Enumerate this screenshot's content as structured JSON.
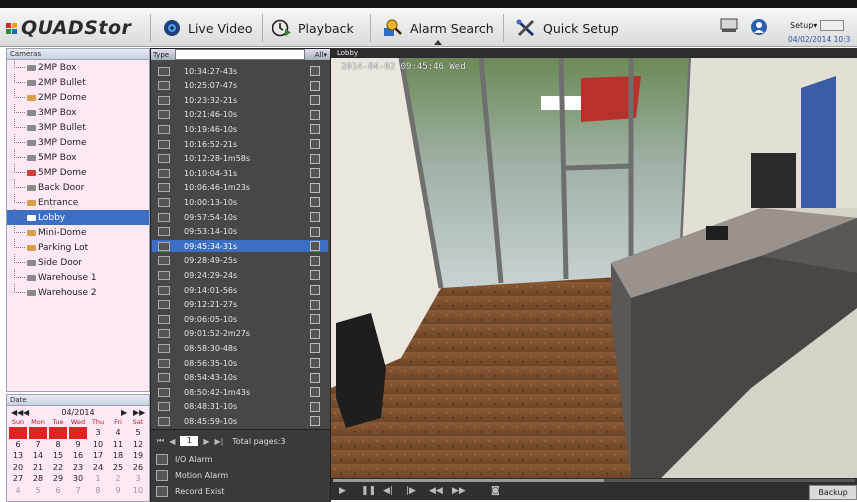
{
  "app": {
    "logo_text": "QUADStor",
    "logo_colors": [
      "#d9262b",
      "#e8a31d",
      "#2d8a3e",
      "#2564b8"
    ]
  },
  "menu": {
    "live_video": "Live Video",
    "playback": "Playback",
    "alarm_search": "Alarm Search",
    "quick_setup": "Quick Setup",
    "active": "alarm_search"
  },
  "header": {
    "setup_label": "Setup",
    "setup_caret": "▾",
    "date": "04/02/2014 10:3"
  },
  "cameras": {
    "title": "Cameras",
    "items": [
      {
        "label": "2MP Box",
        "status": "idle"
      },
      {
        "label": "2MP Bullet",
        "status": "idle"
      },
      {
        "label": "2MP Dome",
        "status": "ok"
      },
      {
        "label": "3MP Box",
        "status": "idle"
      },
      {
        "label": "3MP Bullet",
        "status": "idle"
      },
      {
        "label": "3MP Dome",
        "status": "idle"
      },
      {
        "label": "5MP Box",
        "status": "idle"
      },
      {
        "label": "5MP Dome",
        "status": "alarm"
      },
      {
        "label": "Back Door",
        "status": "idle"
      },
      {
        "label": "Entrance",
        "status": "ok"
      },
      {
        "label": "Lobby",
        "status": "selected"
      },
      {
        "label": "Mini-Dome",
        "status": "ok"
      },
      {
        "label": "Parking Lot",
        "status": "ok"
      },
      {
        "label": "Side Door",
        "status": "idle"
      },
      {
        "label": "Warehouse 1",
        "status": "idle"
      },
      {
        "label": "Warehouse 2",
        "status": "idle"
      }
    ]
  },
  "date_panel": {
    "title": "Date",
    "month": "04/2014",
    "nav_first": "◀◀",
    "nav_prev": "◀",
    "nav_next": "▶",
    "nav_last": "▶▶",
    "weekdays": [
      "Sun",
      "Mon",
      "Tue",
      "Wed",
      "Thu",
      "Fri",
      "Sat"
    ],
    "days": [
      {
        "d": "",
        "t": "rec"
      },
      {
        "d": "",
        "t": "rec"
      },
      {
        "d": "",
        "t": "rec"
      },
      {
        "d": "",
        "t": "rec"
      },
      {
        "d": "3",
        "t": "n"
      },
      {
        "d": "4",
        "t": "n"
      },
      {
        "d": "5",
        "t": "n"
      },
      {
        "d": "6",
        "t": "n"
      },
      {
        "d": "7",
        "t": "n"
      },
      {
        "d": "8",
        "t": "n"
      },
      {
        "d": "9",
        "t": "n"
      },
      {
        "d": "10",
        "t": "n"
      },
      {
        "d": "11",
        "t": "n"
      },
      {
        "d": "12",
        "t": "n"
      },
      {
        "d": "13",
        "t": "n"
      },
      {
        "d": "14",
        "t": "n"
      },
      {
        "d": "15",
        "t": "n"
      },
      {
        "d": "16",
        "t": "n"
      },
      {
        "d": "17",
        "t": "n"
      },
      {
        "d": "18",
        "t": "n"
      },
      {
        "d": "19",
        "t": "n"
      },
      {
        "d": "20",
        "t": "n"
      },
      {
        "d": "21",
        "t": "n"
      },
      {
        "d": "22",
        "t": "n"
      },
      {
        "d": "23",
        "t": "n"
      },
      {
        "d": "24",
        "t": "n"
      },
      {
        "d": "25",
        "t": "n"
      },
      {
        "d": "26",
        "t": "n"
      },
      {
        "d": "27",
        "t": "n"
      },
      {
        "d": "28",
        "t": "n"
      },
      {
        "d": "29",
        "t": "n"
      },
      {
        "d": "30",
        "t": "n"
      },
      {
        "d": "1",
        "t": "other"
      },
      {
        "d": "2",
        "t": "other"
      },
      {
        "d": "3",
        "t": "other"
      },
      {
        "d": "4",
        "t": "other"
      },
      {
        "d": "5",
        "t": "other"
      },
      {
        "d": "6",
        "t": "other"
      },
      {
        "d": "7",
        "t": "other"
      },
      {
        "d": "8",
        "t": "other"
      },
      {
        "d": "9",
        "t": "other"
      },
      {
        "d": "10",
        "t": "other"
      }
    ]
  },
  "recordings": {
    "type_label": "Type",
    "type_value": "All",
    "type_caret": "▾",
    "selected_index": 12,
    "items": [
      "10:34:27-43s",
      "10:25:07-47s",
      "10:23:32-21s",
      "10:21:46-10s",
      "10:19:46-10s",
      "10:16:52-21s",
      "10:12:28-1m58s",
      "10:10:04-31s",
      "10:06:46-1m23s",
      "10:00:13-10s",
      "09:57:54-10s",
      "09:53:14-10s",
      "09:45:34-31s",
      "09:28:49-25s",
      "09:24:29-24s",
      "09:14:01-56s",
      "09:12:21-27s",
      "09:06:05-10s",
      "09:01:52-2m27s",
      "08:58:30-48s",
      "08:56:35-10s",
      "08:54:43-10s",
      "08:50:42-1m43s",
      "08:48:31-10s",
      "08:45:59-10s"
    ],
    "pager": {
      "first": "⏮",
      "prev": "◀",
      "page": "1",
      "next": "▶",
      "last": "▶|",
      "total": "Total pages:3"
    },
    "legend": {
      "io_alarm": "I/O Alarm",
      "motion_alarm": "Motion Alarm",
      "record_exist": "Record Exist"
    }
  },
  "video": {
    "title": "Lobby",
    "osd": "2014-04-02 09:45:46 Wed",
    "progress": 0.52,
    "controls": {
      "play": "▶",
      "pause": "❚❚",
      "step_back": "◀|",
      "step_fwd": "|▶",
      "rewind": "◀◀",
      "fast_fwd": "▶▶",
      "snapshot": "◙"
    },
    "backup_label": "Backup"
  }
}
